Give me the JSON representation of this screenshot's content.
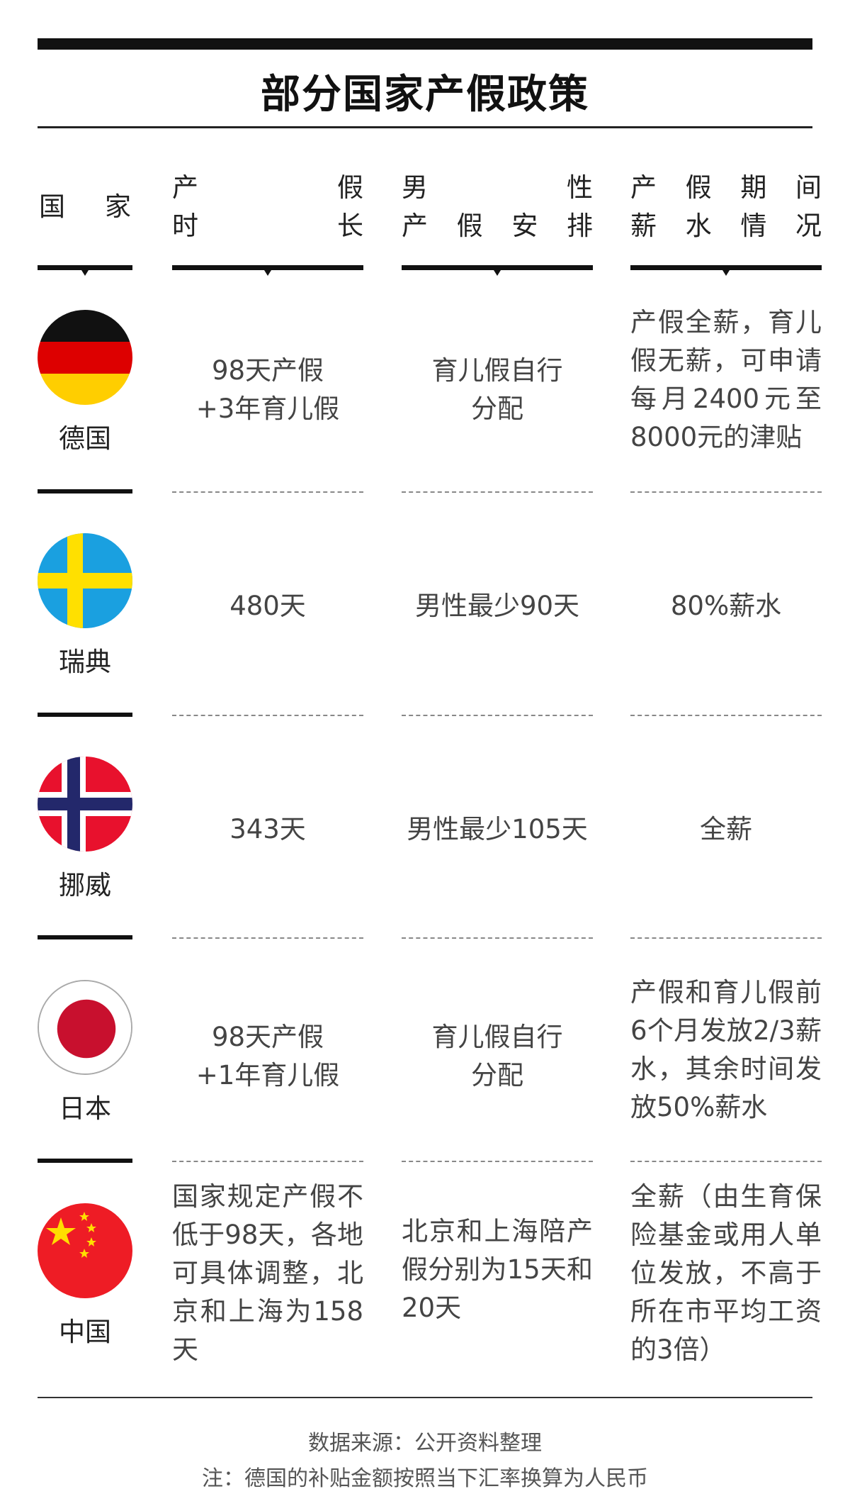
{
  "title": "部分国家产假政策",
  "headers": {
    "country": "国 家",
    "leave_length": [
      "产 假",
      "时 长"
    ],
    "male_leave": [
      "男 性",
      "产假安排"
    ],
    "salary": [
      "产假期间",
      "薪水情况"
    ]
  },
  "rows": [
    {
      "country": "德国",
      "flag": "germany-flag",
      "leave_length": "98天产假\n+3年育儿假",
      "male_leave": "育儿假自行\n分配",
      "salary": "产假全薪，育儿假无薪，可申请每月2400元至8000元的津贴"
    },
    {
      "country": "瑞典",
      "flag": "sweden-flag",
      "leave_length": "480天",
      "male_leave": "男性最少90天",
      "salary": "80%薪水"
    },
    {
      "country": "挪威",
      "flag": "norway-flag",
      "leave_length": "343天",
      "male_leave": "男性最少105天",
      "salary": "全薪"
    },
    {
      "country": "日本",
      "flag": "japan-flag",
      "leave_length": "98天产假\n+1年育儿假",
      "male_leave": "育儿假自行\n分配",
      "salary": "产假和育儿假前6个月发放2/3薪水，其余时间发放50%薪水"
    },
    {
      "country": "中国",
      "flag": "china-flag",
      "leave_length": "国家规定产假不低于98天，各地可具体调整，北京和上海为158天",
      "male_leave": "北京和上海陪产假分别为15天和20天",
      "salary": "全薪（由生育保险基金或用人单位发放，不高于所在市平均工资的3倍）"
    }
  ],
  "footer": {
    "source": "数据来源：公开资料整理",
    "note": "注：德国的补贴金额按照当下汇率换算为人民币"
  }
}
